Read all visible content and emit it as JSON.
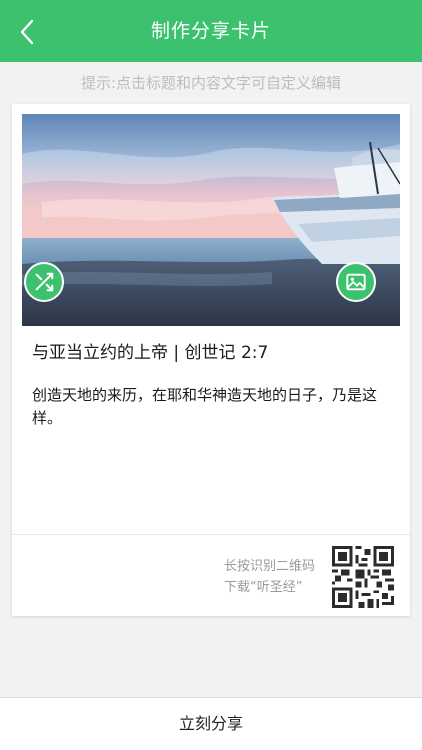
{
  "header": {
    "title": "制作分享卡片",
    "back_icon": "chevron-left-icon"
  },
  "hint": "提示:点击标题和内容文字可自定义编辑",
  "card": {
    "shuffle_icon": "shuffle-icon",
    "image_icon": "image-icon",
    "title": "与亚当立约的上帝 | 创世记 2:7",
    "body": "创造天地的来历，在耶和华神造天地的日子，乃是这样。",
    "qr_line1": "长按识别二维码",
    "qr_line2": "下载“听圣经”"
  },
  "footer": {
    "share_label": "立刻分享"
  },
  "colors": {
    "accent": "#3cc16f",
    "background": "#f2f2f2"
  }
}
